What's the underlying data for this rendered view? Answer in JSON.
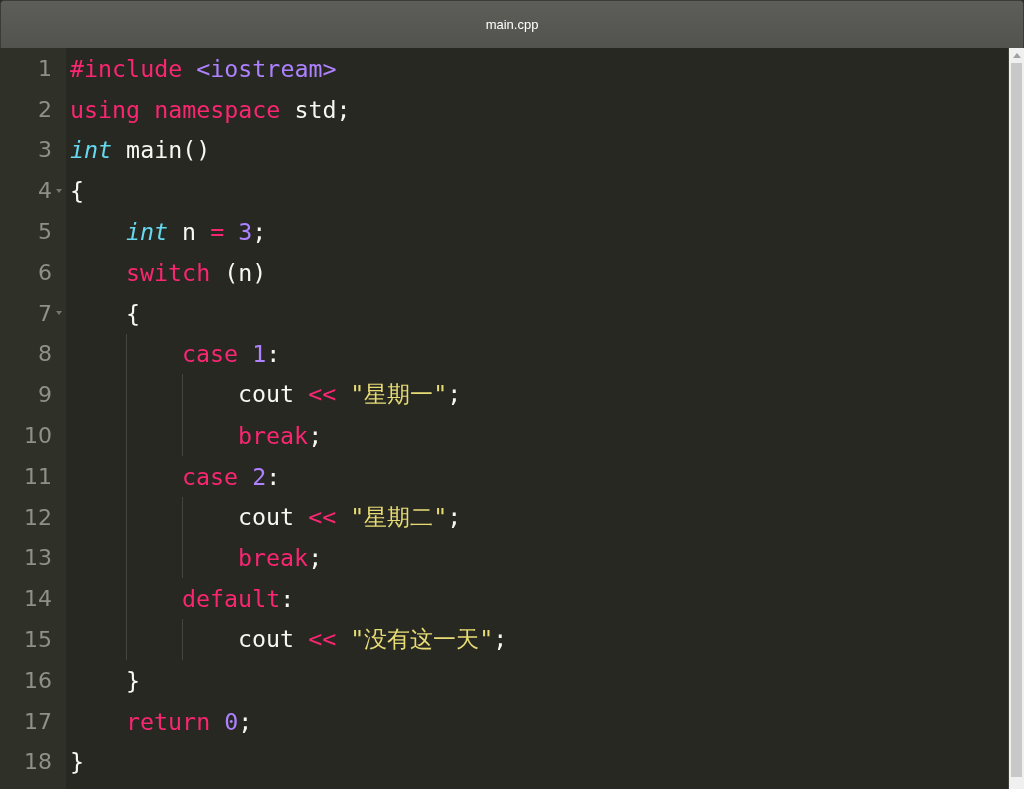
{
  "window": {
    "title": "main.cpp"
  },
  "lines": [
    {
      "number": "1",
      "foldable": false,
      "tokens": [
        {
          "kind": "keyword",
          "text": "#include"
        },
        {
          "kind": "constant",
          "text": " <iostream>"
        }
      ]
    },
    {
      "number": "2",
      "foldable": false,
      "tokens": [
        {
          "kind": "keyword",
          "text": "using"
        },
        {
          "kind": "keyword",
          "text": " namespace"
        },
        {
          "kind": "plain",
          "text": " std;"
        }
      ]
    },
    {
      "number": "3",
      "foldable": false,
      "tokens": [
        {
          "kind": "type",
          "text": "int"
        },
        {
          "kind": "plain",
          "text": " main()"
        }
      ]
    },
    {
      "number": "4",
      "foldable": true,
      "tokens": [
        {
          "kind": "plain",
          "text": "{"
        }
      ],
      "children": [
        {
          "number": "5",
          "foldable": false,
          "tokens": [
            {
              "kind": "type",
              "text": "int"
            },
            {
              "kind": "plain",
              "text": " n "
            },
            {
              "kind": "keyword",
              "text": "="
            },
            {
              "kind": "constant",
              "text": " 3"
            },
            {
              "kind": "plain",
              "text": ";"
            }
          ]
        },
        {
          "number": "6",
          "foldable": false,
          "tokens": [
            {
              "kind": "keyword",
              "text": "switch"
            },
            {
              "kind": "plain",
              "text": " (n)"
            }
          ]
        },
        {
          "number": "7",
          "foldable": true,
          "tokens": [
            {
              "kind": "plain",
              "text": "{"
            }
          ],
          "children": [
            {
              "number": "8",
              "foldable": false,
              "tokens": [
                {
                  "kind": "keyword",
                  "text": "case"
                },
                {
                  "kind": "constant",
                  "text": " 1"
                },
                {
                  "kind": "plain",
                  "text": ":"
                }
              ],
              "children": [
                {
                  "number": "9",
                  "foldable": false,
                  "tokens": [
                    {
                      "kind": "plain",
                      "text": "cout "
                    },
                    {
                      "kind": "keyword",
                      "text": "<<"
                    },
                    {
                      "kind": "string",
                      "text": " \"星期一\""
                    },
                    {
                      "kind": "plain",
                      "text": ";"
                    }
                  ]
                },
                {
                  "number": "10",
                  "foldable": false,
                  "tokens": [
                    {
                      "kind": "keyword",
                      "text": "break"
                    },
                    {
                      "kind": "plain",
                      "text": ";"
                    }
                  ]
                }
              ]
            },
            {
              "number": "11",
              "foldable": false,
              "tokens": [
                {
                  "kind": "keyword",
                  "text": "case"
                },
                {
                  "kind": "constant",
                  "text": " 2"
                },
                {
                  "kind": "plain",
                  "text": ":"
                }
              ],
              "children": [
                {
                  "number": "12",
                  "foldable": false,
                  "tokens": [
                    {
                      "kind": "plain",
                      "text": "cout "
                    },
                    {
                      "kind": "keyword",
                      "text": "<<"
                    },
                    {
                      "kind": "string",
                      "text": " \"星期二\""
                    },
                    {
                      "kind": "plain",
                      "text": ";"
                    }
                  ]
                },
                {
                  "number": "13",
                  "foldable": false,
                  "tokens": [
                    {
                      "kind": "keyword",
                      "text": "break"
                    },
                    {
                      "kind": "plain",
                      "text": ";"
                    }
                  ]
                }
              ]
            },
            {
              "number": "14",
              "foldable": false,
              "tokens": [
                {
                  "kind": "keyword",
                  "text": "default"
                },
                {
                  "kind": "plain",
                  "text": ":"
                }
              ],
              "children": [
                {
                  "number": "15",
                  "foldable": false,
                  "tokens": [
                    {
                      "kind": "plain",
                      "text": "cout "
                    },
                    {
                      "kind": "keyword",
                      "text": "<<"
                    },
                    {
                      "kind": "string",
                      "text": " \"没有这一天\""
                    },
                    {
                      "kind": "plain",
                      "text": ";"
                    }
                  ]
                }
              ]
            }
          ]
        },
        {
          "number": "16",
          "foldable": false,
          "tokens": [
            {
              "kind": "plain",
              "text": "}"
            }
          ]
        },
        {
          "number": "17",
          "foldable": false,
          "tokens": [
            {
              "kind": "keyword",
              "text": "return"
            },
            {
              "kind": "constant",
              "text": " 0"
            },
            {
              "kind": "plain",
              "text": ";"
            }
          ]
        }
      ]
    },
    {
      "number": "18",
      "foldable": false,
      "tokens": [
        {
          "kind": "plain",
          "text": "}"
        }
      ]
    }
  ]
}
